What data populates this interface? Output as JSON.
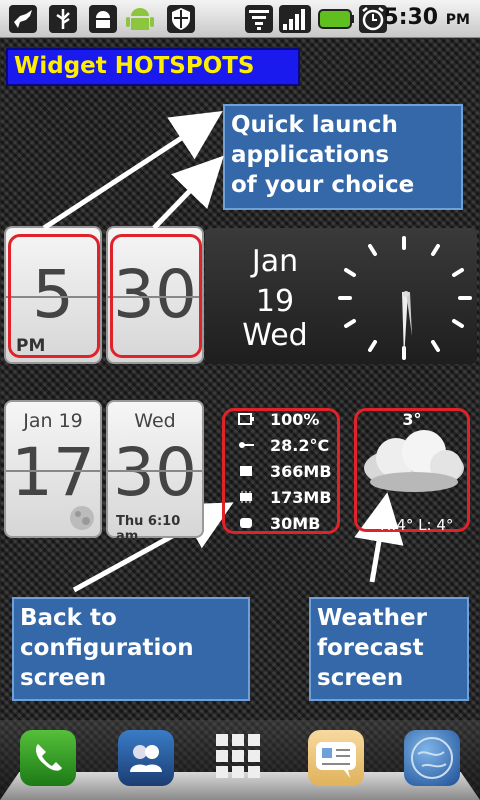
{
  "status_bar": {
    "time": "5:30",
    "ampm": "PM",
    "icons": [
      "bird-icon",
      "usb-icon",
      "android-debug-icon",
      "android-icon",
      "shield-icon",
      "wifi-icon",
      "signal-icon",
      "battery-icon",
      "alarm-clock-icon"
    ]
  },
  "title": "Widget HOTSPOTS",
  "callouts": {
    "quick_launch": "Quick launch\napplications\nof your choice",
    "back_config": "Back to\nconfiguration\nscreen",
    "weather": "Weather\nforecast\nscreen"
  },
  "clock_widget": {
    "hour": "5",
    "minute": "30",
    "ampm": "PM",
    "month_day": "Jan",
    "day": "19",
    "weekday": "Wed"
  },
  "info_widget": {
    "date": "Jan  19",
    "day_number": "17",
    "weekday": "Wed",
    "minutes": "30",
    "alarm": "Thu 6:10 am",
    "stats": {
      "battery": "100%",
      "temperature": "28.2°C",
      "storage": "366MB",
      "memory": "173MB",
      "sd": "30MB"
    },
    "weather": {
      "temp": "3°",
      "hilo": "H:4° L: 4°"
    }
  },
  "dock": [
    "phone-icon",
    "contacts-icon",
    "app-drawer-icon",
    "messaging-icon",
    "browser-icon"
  ]
}
